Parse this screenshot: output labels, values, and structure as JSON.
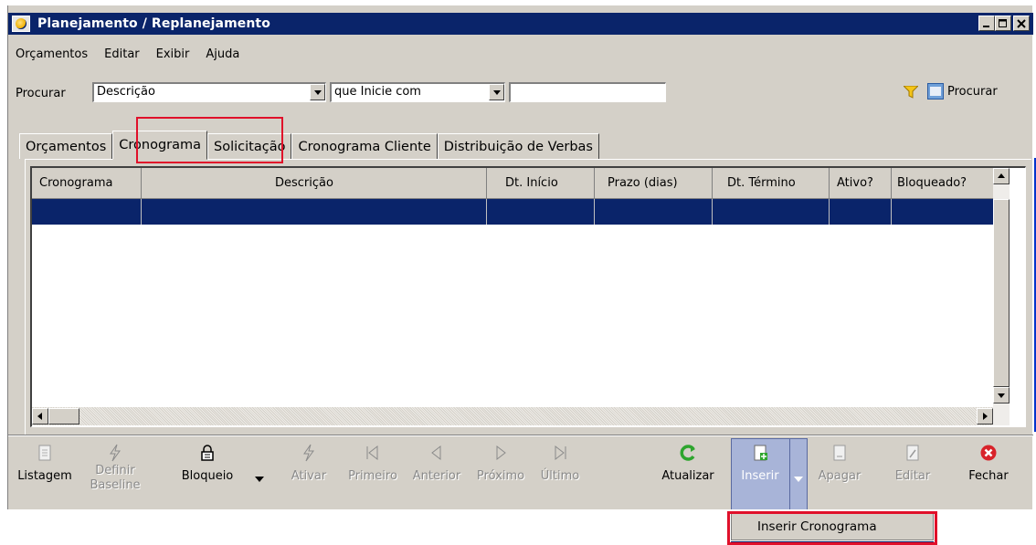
{
  "window": {
    "title": "Planejamento / Replanejamento",
    "controls": [
      "minimize",
      "maximize",
      "close"
    ]
  },
  "menu": [
    {
      "label": "Orçamentos"
    },
    {
      "label": "Editar"
    },
    {
      "label": "Exibir"
    },
    {
      "label": "Ajuda"
    }
  ],
  "search": {
    "label": "Procurar",
    "field_value": "Descrição",
    "condition_value": "que Inicie com",
    "text_value": "",
    "button_label": "Procurar"
  },
  "tabs": [
    {
      "label": "Orçamentos",
      "active": false
    },
    {
      "label": "Cronograma",
      "active": true
    },
    {
      "label": "Solicitação",
      "active": false
    },
    {
      "label": "Cronograma Cliente",
      "active": false
    },
    {
      "label": "Distribuição de Verbas",
      "active": false
    }
  ],
  "grid": {
    "columns": [
      "Cronograma",
      "Descrição",
      "Dt. Início",
      "Prazo (dias)",
      "Dt. Término",
      "Ativo?",
      "Bloqueado?"
    ],
    "rows": []
  },
  "toolbar": {
    "listagem": "Listagem",
    "definir_line1": "Definir",
    "definir_line2": "Baseline",
    "bloqueio": "Bloqueio",
    "ativar": "Ativar",
    "primeiro": "Primeiro",
    "anterior": "Anterior",
    "proximo": "Próximo",
    "ultimo": "Último",
    "atualizar": "Atualizar",
    "inserir": "Inserir",
    "apagar": "Apagar",
    "editar": "Editar",
    "fechar": "Fechar"
  },
  "dropdown": {
    "item": "Inserir Cronograma"
  },
  "colors": {
    "title_bar": "#0a246a",
    "highlight": "#e0102a",
    "selected_row": "#0a246a",
    "face": "#d4d0c8"
  }
}
